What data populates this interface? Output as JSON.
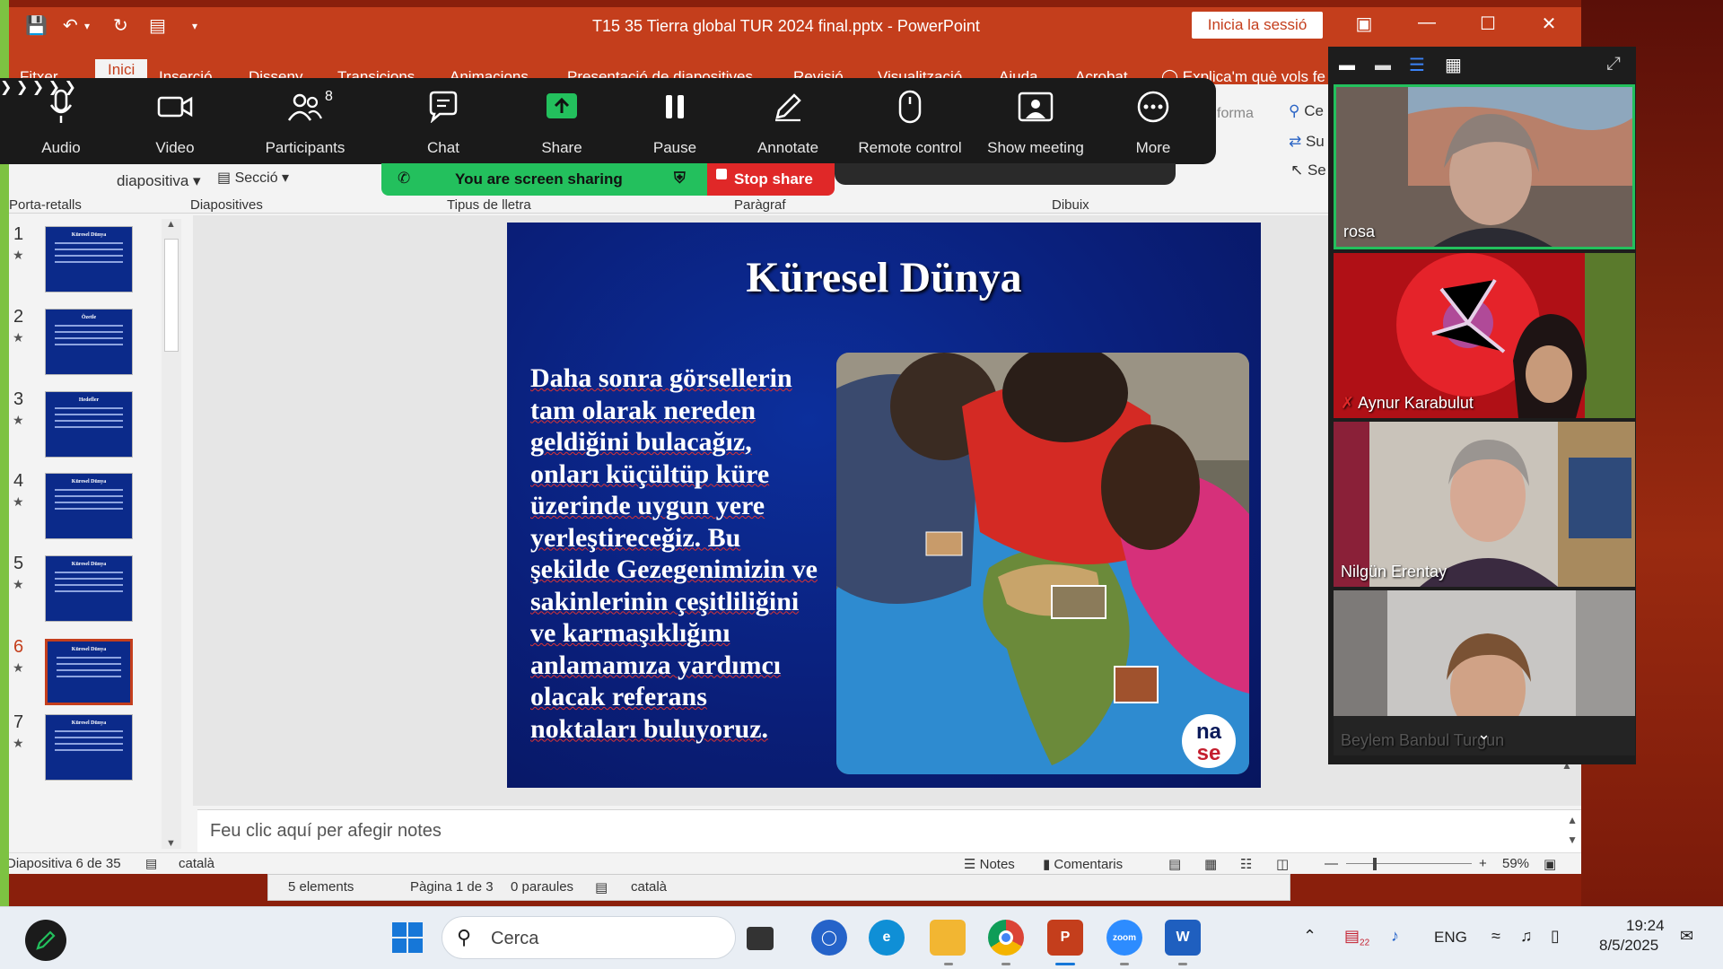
{
  "window": {
    "title": "T15 35 Tierra global  TUR 2024 final.pptx  -  PowerPoint",
    "signin_label": "Inicia la sessió"
  },
  "ribbon_tabs": [
    {
      "label": "Fitxer"
    },
    {
      "label": "Inici",
      "active": true
    },
    {
      "label": "Inserció"
    },
    {
      "label": "Disseny"
    },
    {
      "label": "Transicions"
    },
    {
      "label": "Animacions"
    },
    {
      "label": "Presentació de diapositives"
    },
    {
      "label": "Revisió"
    },
    {
      "label": "Visualització"
    },
    {
      "label": "Ajuda"
    },
    {
      "label": "Acrobat"
    }
  ],
  "tell_me": "Explica'm què vols fe",
  "ribbon": {
    "groups": [
      "Porta-retalls",
      "Diapositives",
      "Tipus de lletra",
      "Paràgraf",
      "Dibuix"
    ],
    "diapositiva_label": "diapositiva",
    "seccio_label": "Secció",
    "forma_label": "forma",
    "search_fragments": [
      "Ce",
      "Su",
      "Se"
    ]
  },
  "thumbnails": [
    {
      "num": "1",
      "title": "Küresel Dünya"
    },
    {
      "num": "2",
      "title": "Özetle"
    },
    {
      "num": "3",
      "title": "Hedefler"
    },
    {
      "num": "4",
      "title": "Küresel Dünya"
    },
    {
      "num": "5",
      "title": "Küresel Dünya"
    },
    {
      "num": "6",
      "title": "Küresel Dünya",
      "selected": true
    },
    {
      "num": "7",
      "title": "Küresel Dünya"
    }
  ],
  "slide": {
    "title": "Küresel Dünya",
    "body": "Daha sonra görsellerin tam olarak nereden geldiğini bulacağız, onları küçültüp küre üzerinde uygun yere yerleştireceğiz. Bu şekilde Gezegenimizin ve sakinlerinin çeşitliliğini ve karmaşıklığını anlamamıza yardımcı olacak referans noktaları buluyoruz.",
    "logo_top": "na",
    "logo_bottom": "se"
  },
  "notes_placeholder": "Feu clic aquí per afegir notes",
  "status": {
    "slide_counter": "Diapositiva 6 de 35",
    "language": "català",
    "notes_btn": "Notes",
    "comments_btn": "Comentaris",
    "zoom": "59%"
  },
  "word_strip": {
    "elements": "5 elements",
    "page": "Pàgina 1 de 3",
    "words": "0 paraules",
    "language": "català"
  },
  "zoom_toolbar": {
    "audio": "Audio",
    "video": "Video",
    "participants": "Participants",
    "participants_count": "8",
    "chat": "Chat",
    "share": "Share",
    "pause": "Pause",
    "annotate": "Annotate",
    "remote_control": "Remote control",
    "show_meeting": "Show meeting",
    "more": "More",
    "sharing_banner": "You are screen sharing",
    "stop_share": "Stop share"
  },
  "gallery": {
    "participants": [
      {
        "name": "rosa"
      },
      {
        "name": "Aynur Karabulut",
        "muted": true
      },
      {
        "name": "Nilgün Erentay"
      },
      {
        "name": "Beylem Banbul Turgun"
      }
    ]
  },
  "taskbar": {
    "search_placeholder": "Cerca",
    "lang": "ENG",
    "time": "19:24",
    "date": "8/5/2025",
    "calendar_badge": "22"
  },
  "colors": {
    "ppt_accent": "#c43e1c",
    "zoom_share_green": "#23c05d",
    "stop_red": "#e02828"
  }
}
